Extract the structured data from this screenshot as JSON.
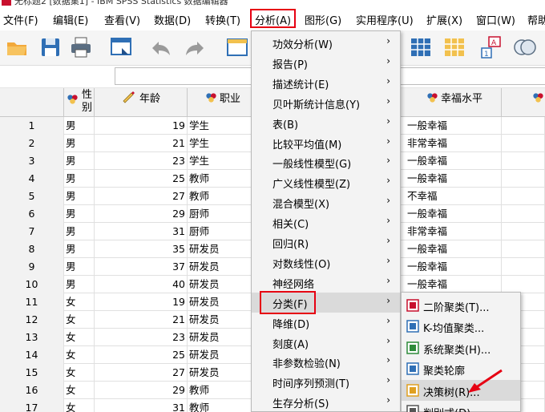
{
  "window": {
    "title": "无标题2 [数据集1] - IBM SPSS Statistics 数据编辑器"
  },
  "menubar": [
    {
      "label": "文件(F)"
    },
    {
      "label": "编辑(E)"
    },
    {
      "label": "查看(V)"
    },
    {
      "label": "数据(D)"
    },
    {
      "label": "转换(T)"
    },
    {
      "label": "分析(A)"
    },
    {
      "label": "图形(G)"
    },
    {
      "label": "实用程序(U)"
    },
    {
      "label": "扩展(X)"
    },
    {
      "label": "窗口(W)"
    },
    {
      "label": "帮助"
    }
  ],
  "columns": {
    "sex": "性别",
    "age": "年龄",
    "job": "职业",
    "happiness": "幸福水平"
  },
  "rows": [
    {
      "n": "1",
      "sex": "男",
      "age": "19",
      "job": "学生",
      "happiness": "一般幸福"
    },
    {
      "n": "2",
      "sex": "男",
      "age": "21",
      "job": "学生",
      "happiness": "非常幸福"
    },
    {
      "n": "3",
      "sex": "男",
      "age": "23",
      "job": "学生",
      "happiness": "一般幸福"
    },
    {
      "n": "4",
      "sex": "男",
      "age": "25",
      "job": "教师",
      "happiness": "一般幸福"
    },
    {
      "n": "5",
      "sex": "男",
      "age": "27",
      "job": "教师",
      "happiness": "不幸福"
    },
    {
      "n": "6",
      "sex": "男",
      "age": "29",
      "job": "厨师",
      "happiness": "一般幸福"
    },
    {
      "n": "7",
      "sex": "男",
      "age": "31",
      "job": "厨师",
      "happiness": "非常幸福"
    },
    {
      "n": "8",
      "sex": "男",
      "age": "35",
      "job": "研发员",
      "happiness": "一般幸福"
    },
    {
      "n": "9",
      "sex": "男",
      "age": "37",
      "job": "研发员",
      "happiness": "一般幸福"
    },
    {
      "n": "10",
      "sex": "男",
      "age": "40",
      "job": "研发员",
      "happiness": "一般幸福"
    },
    {
      "n": "11",
      "sex": "女",
      "age": "19",
      "job": "研发员",
      "happiness": ""
    },
    {
      "n": "12",
      "sex": "女",
      "age": "21",
      "job": "研发员",
      "happiness": ""
    },
    {
      "n": "13",
      "sex": "女",
      "age": "23",
      "job": "研发员",
      "happiness": ""
    },
    {
      "n": "14",
      "sex": "女",
      "age": "25",
      "job": "研发员",
      "happiness": ""
    },
    {
      "n": "15",
      "sex": "女",
      "age": "27",
      "job": "研发员",
      "happiness": ""
    },
    {
      "n": "16",
      "sex": "女",
      "age": "29",
      "job": "教师",
      "happiness": ""
    },
    {
      "n": "17",
      "sex": "女",
      "age": "31",
      "job": "教师",
      "happiness": ""
    }
  ],
  "analyze_menu": [
    {
      "label": "功效分析(W)"
    },
    {
      "label": "报告(P)"
    },
    {
      "label": "描述统计(E)"
    },
    {
      "label": "贝叶斯统计信息(Y)"
    },
    {
      "label": "表(B)"
    },
    {
      "label": "比较平均值(M)"
    },
    {
      "label": "一般线性模型(G)"
    },
    {
      "label": "广义线性模型(Z)"
    },
    {
      "label": "混合模型(X)"
    },
    {
      "label": "相关(C)"
    },
    {
      "label": "回归(R)"
    },
    {
      "label": "对数线性(O)"
    },
    {
      "label": "神经网络"
    },
    {
      "label": "分类(F)"
    },
    {
      "label": "降维(D)"
    },
    {
      "label": "刻度(A)"
    },
    {
      "label": "非参数检验(N)"
    },
    {
      "label": "时间序列预测(T)"
    },
    {
      "label": "生存分析(S)"
    }
  ],
  "classify_submenu": [
    {
      "label": "二阶聚类(T)...",
      "icon": "twostep-cluster-icon"
    },
    {
      "label": "K-均值聚类...",
      "icon": "kmeans-cluster-icon"
    },
    {
      "label": "系统聚类(H)...",
      "icon": "hierarchical-cluster-icon"
    },
    {
      "label": "聚类轮廓",
      "icon": "cluster-silhouette-icon"
    },
    {
      "label": "决策树(R)...",
      "icon": "decision-tree-icon"
    },
    {
      "label": "判别式(D)...",
      "icon": "discriminant-icon"
    }
  ],
  "colors": {
    "highlight_box": "#e60012",
    "arrow": "#e60012"
  }
}
